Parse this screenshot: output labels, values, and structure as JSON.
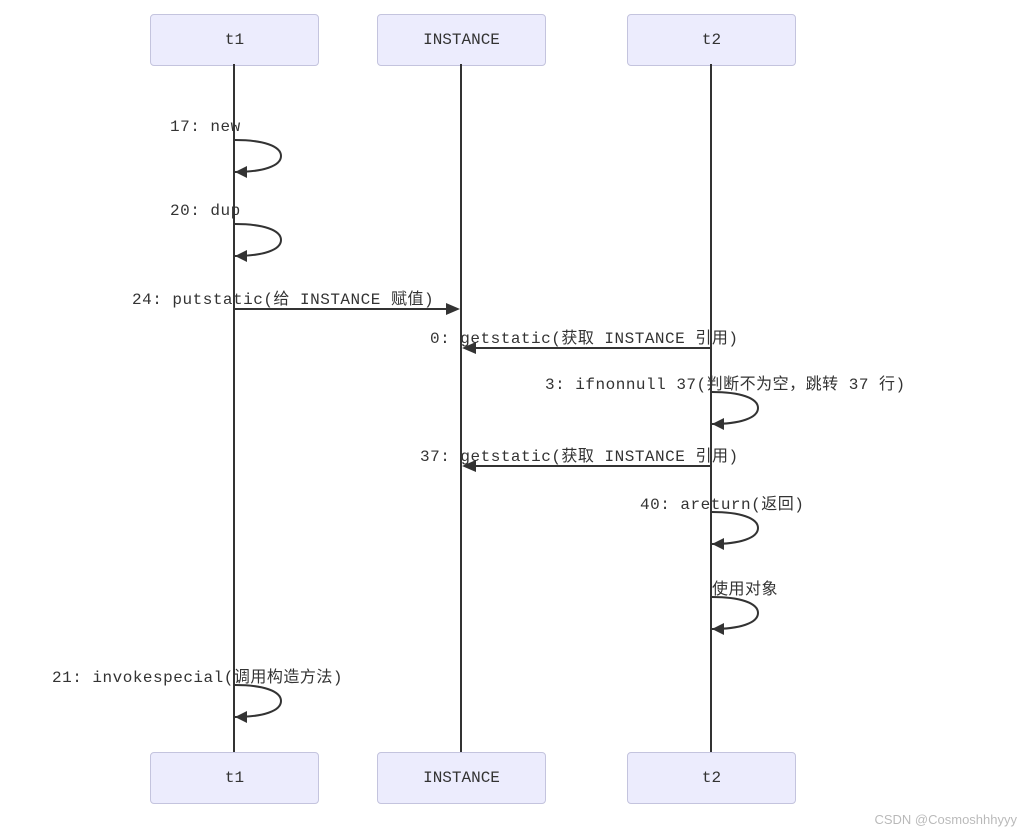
{
  "participants": {
    "t1_top": "t1",
    "instance_top": "INSTANCE",
    "t2_top": "t2",
    "t1_bottom": "t1",
    "instance_bottom": "INSTANCE",
    "t2_bottom": "t2"
  },
  "messages": {
    "m17": "17: new",
    "m20": "20: dup",
    "m24": "24: putstatic(给 INSTANCE 赋值)",
    "m0": "0: getstatic(获取 INSTANCE 引用)",
    "m3": "3: ifnonnull 37(判断不为空，跳转 37 行)",
    "m37": "37: getstatic(获取 INSTANCE 引用)",
    "m40": "40: areturn(返回)",
    "mUse": "使用对象",
    "m21": "21: invokespecial(调用构造方法)"
  },
  "watermark": "CSDN @Cosmoshhhyyy"
}
